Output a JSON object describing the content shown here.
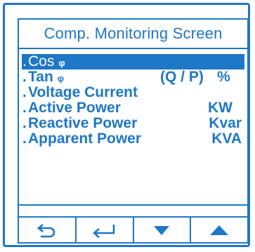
{
  "screen": {
    "title": "Comp. Monitoring Screen"
  },
  "menu": {
    "items": [
      {
        "label": "Cos",
        "symbol": "φ",
        "unit1": "",
        "unit2": ""
      },
      {
        "label": "Tan",
        "symbol": "φ",
        "unit1": "(Q / P)",
        "unit2": "%"
      },
      {
        "label": "Voltage Current",
        "symbol": "",
        "unit1": "",
        "unit2": ""
      },
      {
        "label": "Active Power",
        "symbol": "",
        "unit1": "",
        "unit2": "KW"
      },
      {
        "label": "Reactive Power",
        "symbol": "",
        "unit1": "",
        "unit2": "Kvar"
      },
      {
        "label": "Apparent Power",
        "symbol": "",
        "unit1": "",
        "unit2": "KVA"
      }
    ],
    "bullet": ".",
    "selected_index": 0
  },
  "buttons": [
    {
      "icon": "back-arrow-icon"
    },
    {
      "icon": "enter-arrow-icon"
    },
    {
      "icon": "triangle-down-icon"
    },
    {
      "icon": "triangle-up-icon"
    }
  ],
  "colors": {
    "accent": "#1e77c7",
    "background": "#ffffff",
    "selected_text": "#ffffff"
  }
}
